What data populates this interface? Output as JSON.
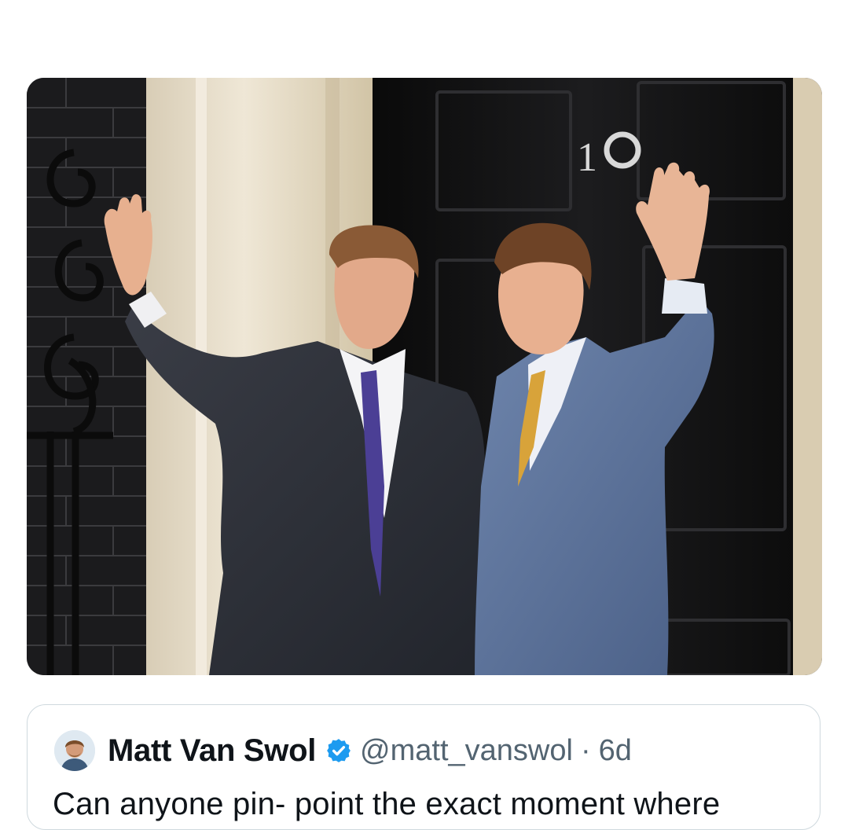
{
  "quoted_post": {
    "author_name": "Matt Van Swol",
    "handle": "@matt_vanswol",
    "separator": "·",
    "age": "6d",
    "text": "Can anyone pin- point the exact moment where"
  },
  "media": {
    "door_number": "10"
  },
  "icons": {
    "verified": "verified-badge-icon",
    "avatar": "profile-avatar"
  },
  "colors": {
    "verified_blue": "#1d9bf0",
    "text_primary": "#0f1419",
    "text_secondary": "#536471",
    "card_border": "#cfd9de"
  }
}
